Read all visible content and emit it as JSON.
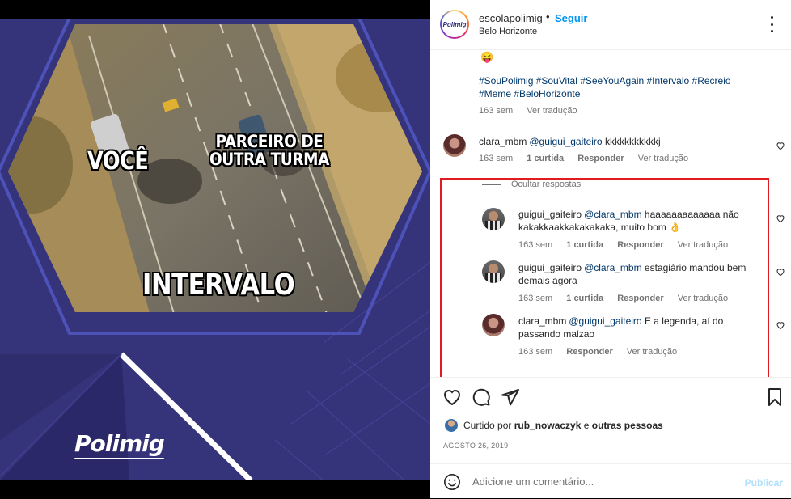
{
  "header": {
    "username": "escolapolimig",
    "separator": "•",
    "follow_label": "Seguir",
    "location": "Belo Horizonte",
    "avatar_logo": "Polimig"
  },
  "post_image": {
    "meme_voce": "VOCÊ",
    "meme_parceiro": "PARCEIRO DE OUTRA TURMA",
    "meme_intervalo": "INTERVALO",
    "brand": "Polimig"
  },
  "caption": {
    "emoji": "😝",
    "hashtags": "#SouPolimig #SouVital #SeeYouAgain #Intervalo #Recreio #Meme #BeloHorizonte",
    "time": "163 sem",
    "translate": "Ver tradução"
  },
  "comments": [
    {
      "user": "clara_mbm",
      "mention": "@guigui_gaiteiro",
      "text": " kkkkkkkkkkkj",
      "time": "163 sem",
      "likes": "1 curtida",
      "reply": "Responder",
      "translate": "Ver tradução"
    }
  ],
  "hide_replies": "Ocultar respostas",
  "replies": [
    {
      "user": "guigui_gaiteiro",
      "mention": "@clara_mbm",
      "text": " haaaaaaaaaaaaa não kakakkaakkakakakaka, muito bom 👌",
      "time": "163 sem",
      "likes": "1 curtida",
      "reply": "Responder",
      "translate": "Ver tradução"
    },
    {
      "user": "guigui_gaiteiro",
      "mention": "@clara_mbm",
      "text": " estagiário mandou bem demais agora",
      "time": "163 sem",
      "likes": "1 curtida",
      "reply": "Responder",
      "translate": "Ver tradução"
    },
    {
      "user": "clara_mbm",
      "mention": "@guigui_gaiteiro",
      "text": " E a legenda, aí do passando malzao",
      "time": "163 sem",
      "reply": "Responder",
      "translate": "Ver tradução"
    }
  ],
  "liked": {
    "prefix": "Curtido por ",
    "user": "rub_nowaczyk",
    "middle": " e ",
    "others": "outras pessoas"
  },
  "date": "AGOSTO 26, 2019",
  "add_comment": {
    "placeholder": "Adicione um comentário...",
    "publish": "Publicar"
  },
  "colors": {
    "accent": "#0095f6",
    "link": "#00376b",
    "highlight_border": "#e11b22",
    "image_bg": "#35337a"
  }
}
